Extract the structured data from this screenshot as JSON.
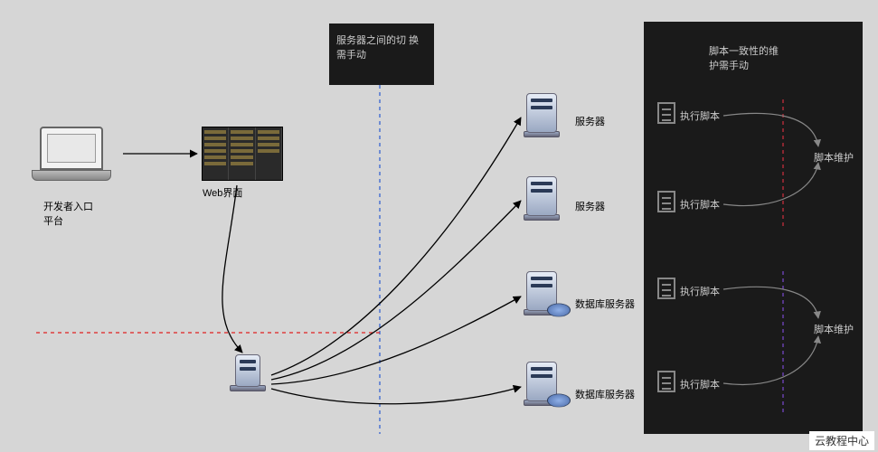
{
  "nodes": {
    "laptop_label": "开发者入口\n平台",
    "webui_label": "Web界面",
    "note1": "服务器之间的切\n换需手动",
    "note2": "脚本一致性的维\n护需手动",
    "server1": "服务器",
    "server2": "服务器",
    "db1": "数据库服务器",
    "db2": "数据库服务器",
    "script1": "执行脚本",
    "script2": "执行脚本",
    "script3": "执行脚本",
    "script4": "执行脚本",
    "maint1": "脚本维护",
    "maint2": "脚本维护"
  },
  "watermark": "云教程中心"
}
